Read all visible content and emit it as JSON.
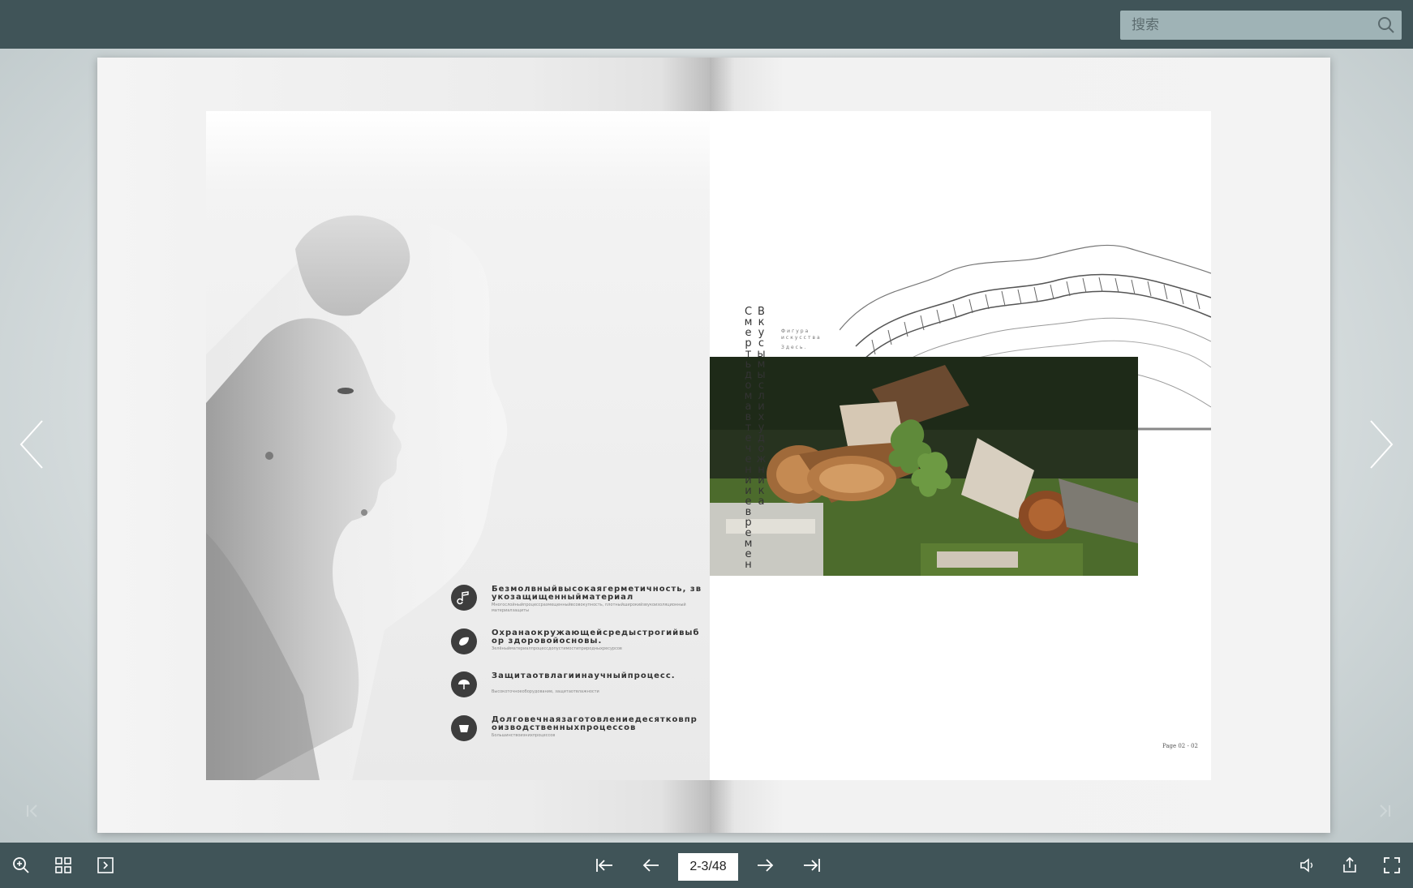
{
  "search": {
    "placeholder": "搜索"
  },
  "pagination": {
    "indicator": "2-3/48"
  },
  "left_page": {
    "features": [
      {
        "icon": "music-note-icon",
        "title": "Безмолвныйвысокаягерметичность, звукозащищенныйматериал",
        "subtitle": "Многослойныйпроцессразмещенныйвсовокупность, плотныйширокийзвукоизоляционныйматериалзащиты"
      },
      {
        "icon": "leaf-icon",
        "title": "Охранаокружающейсредыстрогийвыбор здоровойосновы.",
        "subtitle": "Зелёныйматериалпроцессдопустимостиприродныхресурсов"
      },
      {
        "icon": "umbrella-icon",
        "title": "Защитаотвлагиинаучныйпроцесс.",
        "subtitle": "Высокоточноеоборудование, защитаотвлажности"
      },
      {
        "icon": "cup-icon",
        "title": "Долговечнаязаготовлениедесятковпроизводственныхпроцессов",
        "subtitle": "Большинствоизнихпроцессов"
      }
    ]
  },
  "right_page": {
    "vertical_title_1": "Смертьдомавтеченииевремен",
    "vertical_title_2": "Вкусымыслихудожника",
    "small_caption_1": "Фигура",
    "small_caption_2": "искусства",
    "small_caption_3": "Здесь.",
    "page_number": "Page 02 - 02"
  },
  "colors": {
    "toolbar": "#405458",
    "search_bg": "#9fb3b6",
    "page_bg": "#f3f3f3"
  }
}
